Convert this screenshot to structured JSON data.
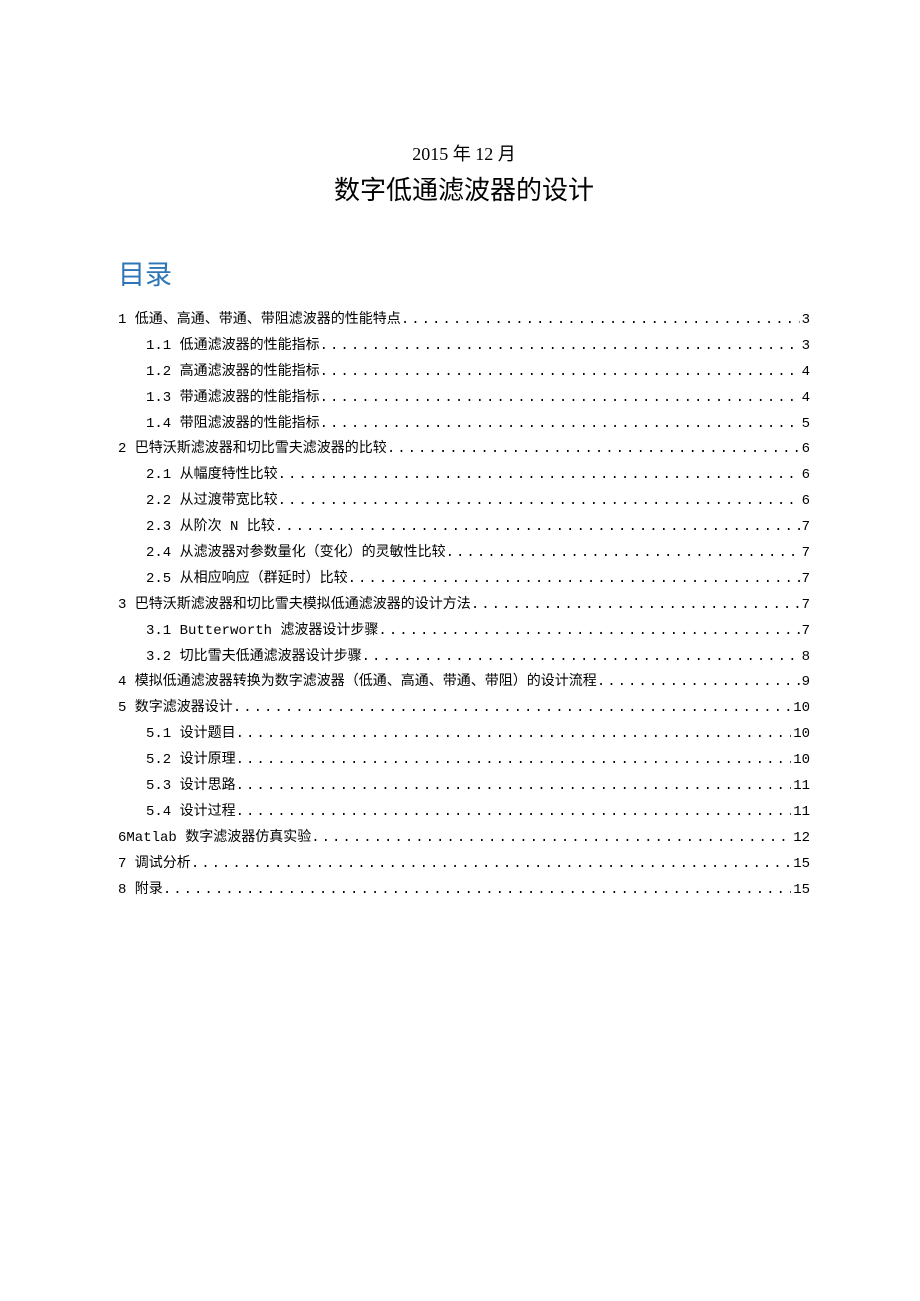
{
  "date_line": "2015 年 12 月",
  "main_title": "数字低通滤波器的设计",
  "toc_heading": "目录",
  "toc": [
    {
      "level": 1,
      "label": "1 低通、高通、带通、带阻滤波器的性能特点",
      "page": "3"
    },
    {
      "level": 2,
      "label": "1.1  低通滤波器的性能指标",
      "page": "3"
    },
    {
      "level": 2,
      "label": "1.2  高通滤波器的性能指标",
      "page": "4"
    },
    {
      "level": 2,
      "label": "1.3  带通滤波器的性能指标",
      "page": "4"
    },
    {
      "level": 2,
      "label": "1.4  带阻滤波器的性能指标",
      "page": "5"
    },
    {
      "level": 1,
      "label": "2 巴特沃斯滤波器和切比雪夫滤波器的比较",
      "page": "6"
    },
    {
      "level": 2,
      "label": "2.1  从幅度特性比较",
      "page": "6"
    },
    {
      "level": 2,
      "label": "2.2  从过渡带宽比较",
      "page": "6"
    },
    {
      "level": 2,
      "label": "2.3  从阶次 N 比较",
      "page": "7"
    },
    {
      "level": 2,
      "label": "2.4  从滤波器对参数量化（变化）的灵敏性比较",
      "page": "7"
    },
    {
      "level": 2,
      "label": "2.5  从相应响应（群延时）比较",
      "page": "7"
    },
    {
      "level": 1,
      "label": "3 巴特沃斯滤波器和切比雪夫模拟低通滤波器的设计方法",
      "page": "7"
    },
    {
      "level": 2,
      "label": "3.1  Butterworth 滤波器设计步骤",
      "page": "7"
    },
    {
      "level": 2,
      "label": "3.2  切比雪夫低通滤波器设计步骤",
      "page": "8"
    },
    {
      "level": 1,
      "label": "4 模拟低通滤波器转换为数字滤波器（低通、高通、带通、带阻）的设计流程",
      "page": "9"
    },
    {
      "level": 1,
      "label": "5 数字滤波器设计",
      "page": "10"
    },
    {
      "level": 2,
      "label": "5.1  设计题目",
      "page": "10"
    },
    {
      "level": 2,
      "label": "5.2  设计原理",
      "page": "10"
    },
    {
      "level": 2,
      "label": "5.3  设计思路",
      "page": "11"
    },
    {
      "level": 2,
      "label": "5.4  设计过程",
      "page": "11"
    },
    {
      "level": 1,
      "label": "6Matlab 数字滤波器仿真实验",
      "page": "12"
    },
    {
      "level": 1,
      "label": "7 调试分析",
      "page": "15"
    },
    {
      "level": 1,
      "label": "8 附录",
      "page": "15"
    }
  ]
}
